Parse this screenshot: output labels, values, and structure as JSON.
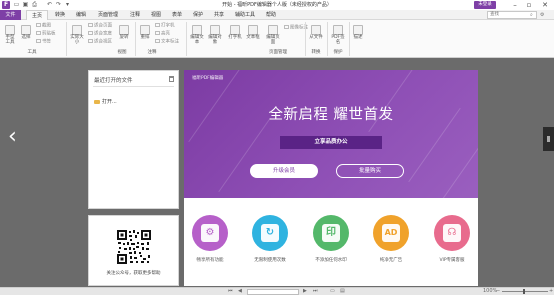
{
  "titlebar": {
    "title": "开始 - 福昕PDF编辑器个人版（未经授权的产品）",
    "sign_button": "未登录",
    "app_icon": "foxit-logo-icon",
    "quick_access": [
      "open-icon",
      "save-icon",
      "print-icon",
      "undo-icon",
      "redo-icon",
      "dropdown-icon"
    ]
  },
  "tabs": [
    "文件",
    "主页",
    "转换",
    "编辑",
    "页面管理",
    "注释",
    "视图",
    "表单",
    "保护",
    "共享",
    "辅助工具",
    "帮助"
  ],
  "active_tab": "主页",
  "search": {
    "placeholder": "查找"
  },
  "ribbon": {
    "groups": [
      {
        "label": "工具",
        "buttons": [
          "手型工具",
          "选择",
          "截图",
          "剪贴板",
          "书签"
        ]
      },
      {
        "label": "视图",
        "buttons": [
          "实际大小",
          "适合页面",
          "适合宽度",
          "适合视区",
          "旋转"
        ]
      },
      {
        "label": "注释",
        "buttons": [
          "重排",
          "打字机",
          "高亮",
          "文本标注",
          "下划线",
          "删除线"
        ]
      },
      {
        "label": "页面管理",
        "buttons": [
          "编辑文本",
          "编辑对象",
          "打字机",
          "文本框",
          "编辑页面",
          "图像标注"
        ]
      },
      {
        "label": "转换",
        "buttons": [
          "从文件"
        ]
      },
      {
        "label": "保护",
        "buttons": [
          "PDF签名"
        ]
      },
      {
        "label": "",
        "buttons": [
          "描述"
        ]
      }
    ]
  },
  "recent": {
    "title": "最近打开的文件",
    "open_label": "打开..."
  },
  "qr_text": "关注公众号，获取更多帮助",
  "promo": {
    "brand": "福昕PDF编辑器",
    "headline": "全新启程 耀世首发",
    "banner": "立享品质办公",
    "buttons": [
      "升级会员",
      "批量购买"
    ]
  },
  "features": [
    {
      "label": "畅享所有功能",
      "color": "#b660c9",
      "icon": "gear-icon",
      "glyph": "⚙"
    },
    {
      "label": "无限制使用次数",
      "color": "#2fb3e0",
      "icon": "refresh-icon",
      "glyph": "↻"
    },
    {
      "label": "不添加任何水印",
      "color": "#54b86a",
      "icon": "watermark-icon",
      "glyph": "印"
    },
    {
      "label": "纯净无广告",
      "color": "#f0a22b",
      "icon": "ad-icon",
      "glyph": "AD"
    },
    {
      "label": "VIP专属客服",
      "color": "#e86b8d",
      "icon": "headset-icon",
      "glyph": "☊"
    }
  ],
  "statusbar": {
    "zoom": "100%"
  },
  "colors": {
    "brand": "#7e3fa6",
    "canvas": "#6b6b6b"
  }
}
